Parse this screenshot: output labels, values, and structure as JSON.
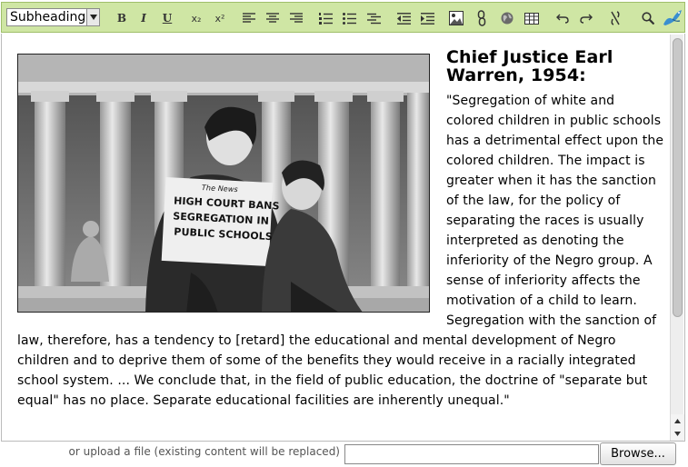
{
  "toolbar": {
    "format_select": "Subheading",
    "buttons": [
      {
        "name": "bold-button",
        "glyph": "B"
      },
      {
        "name": "italic-button",
        "glyph": "I"
      },
      {
        "name": "underline-button",
        "glyph": "U"
      },
      {
        "name": "subscript-button",
        "glyph": "x₂"
      },
      {
        "name": "superscript-button",
        "glyph": "x²"
      }
    ]
  },
  "article": {
    "heading": "Chief Justice Earl Warren, 1954:",
    "body": "\"Segregation of white and colored children in public schools has a detrimental effect upon the colored children. The impact is greater when it has the sanction of the law, for the policy of separating the races is usually interpreted as denoting the inferiority of the Negro group. A sense of inferiority affects the motivation of a child to learn. Segregation with the sanction of law, therefore, has a tendency to [retard] the educational and mental development of Negro children and to deprive them of some of the benefits they would receive in a racially integrated school system. ... We conclude that, in the field of public education, the doctrine of \"separate but equal\" has no place. Separate educational facilities are inherently unequal.\"",
    "photo_newspaper": {
      "masthead": "The News",
      "headline_1": "HIGH COURT BANS",
      "headline_2": "SEGREGATION IN",
      "headline_3": "PUBLIC SCHOOLS"
    }
  },
  "upload": {
    "label": "or upload a file (existing content will be replaced)",
    "button": "Browse..."
  }
}
